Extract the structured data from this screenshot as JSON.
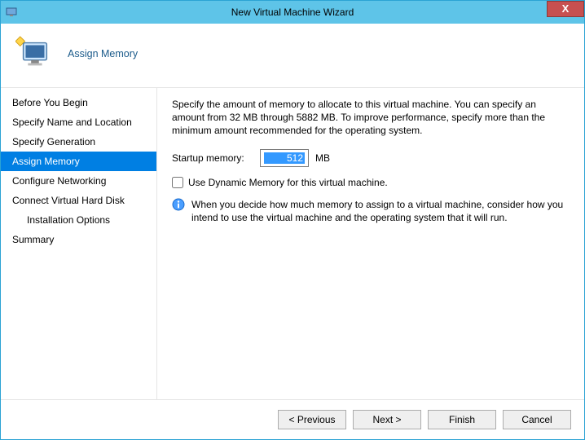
{
  "window": {
    "title": "New Virtual Machine Wizard",
    "close_label": "X"
  },
  "header": {
    "title": "Assign Memory"
  },
  "sidebar": {
    "items": [
      {
        "label": "Before You Begin",
        "indent": false
      },
      {
        "label": "Specify Name and Location",
        "indent": false
      },
      {
        "label": "Specify Generation",
        "indent": false
      },
      {
        "label": "Assign Memory",
        "indent": false
      },
      {
        "label": "Configure Networking",
        "indent": false
      },
      {
        "label": "Connect Virtual Hard Disk",
        "indent": false
      },
      {
        "label": "Installation Options",
        "indent": true
      },
      {
        "label": "Summary",
        "indent": false
      }
    ],
    "active_index": 3
  },
  "main": {
    "description": "Specify the amount of memory to allocate to this virtual machine. You can specify an amount from 32 MB through 5882 MB. To improve performance, specify more than the minimum amount recommended for the operating system.",
    "startup_label": "Startup memory:",
    "startup_value": "512",
    "startup_unit": "MB",
    "dynamic_label": "Use Dynamic Memory for this virtual machine.",
    "dynamic_checked": false,
    "info_text": "When you decide how much memory to assign to a virtual machine, consider how you intend to use the virtual machine and the operating system that it will run."
  },
  "footer": {
    "previous": "< Previous",
    "next": "Next >",
    "finish": "Finish",
    "cancel": "Cancel"
  }
}
